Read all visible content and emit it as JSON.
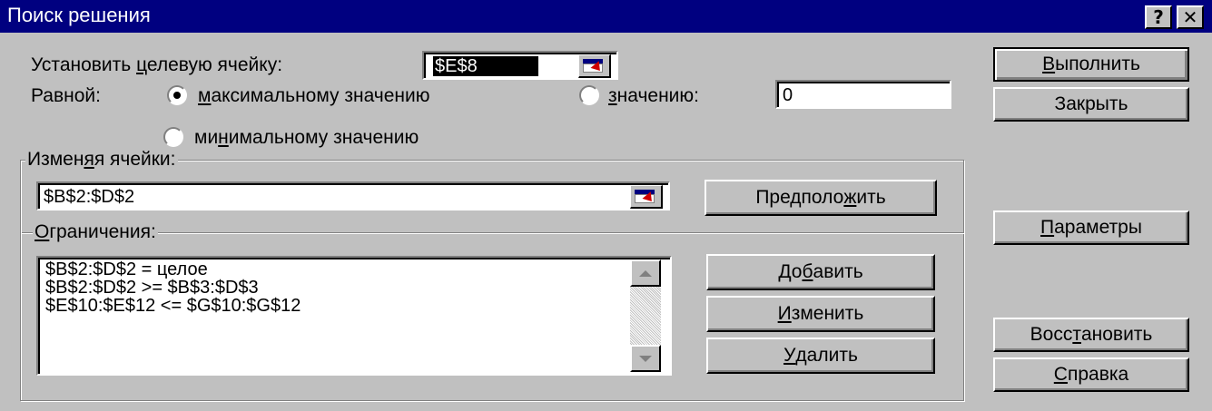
{
  "window": {
    "title": "Поиск решения",
    "help_glyph": "?",
    "close_glyph": "✕"
  },
  "target": {
    "label_pre": "Установить ",
    "label_u": "ц",
    "label_post": "елевую ячейку:",
    "value": "$E$8"
  },
  "equal": {
    "label": "Равной:",
    "max": {
      "u": "м",
      "post": "аксимальному значению",
      "selected": true
    },
    "value_opt": {
      "u": "з",
      "post": "начению:",
      "selected": false
    },
    "value_field": "0",
    "min": {
      "pre": "ми",
      "u": "н",
      "post": "имальному значению",
      "selected": false
    }
  },
  "changing": {
    "legend_pre": "Измен",
    "legend_u": "я",
    "legend_post": "я ячейки:",
    "value": "$B$2:$D$2"
  },
  "constraints": {
    "legend_u": "О",
    "legend_post": "граничения:",
    "items": [
      "$B$2:$D$2 = целое",
      "$B$2:$D$2 >= $B$3:$D$3",
      "$E$10:$E$12 <= $G$10:$G$12"
    ]
  },
  "buttons": {
    "solve": {
      "u": "В",
      "post": "ыполнить"
    },
    "close": "Закрыть",
    "guess": {
      "pre": "Предполо",
      "u": "ж",
      "post": "ить"
    },
    "options": {
      "u": "П",
      "post": "араметры"
    },
    "add": {
      "pre": "До",
      "u": "б",
      "post": "авить"
    },
    "change": {
      "u": "И",
      "post": "зменить"
    },
    "delete": {
      "u": "У",
      "post": "далить"
    },
    "reset": {
      "pre": "Восс",
      "u": "т",
      "post": "ановить"
    },
    "help": {
      "u": "С",
      "post": "правка"
    }
  },
  "colors": {
    "titlebar": "#000080",
    "face": "#c0c0c0"
  },
  "icons": [
    "help-icon",
    "close-icon",
    "cell-reference-icon",
    "scroll-up-icon",
    "scroll-down-icon"
  ]
}
